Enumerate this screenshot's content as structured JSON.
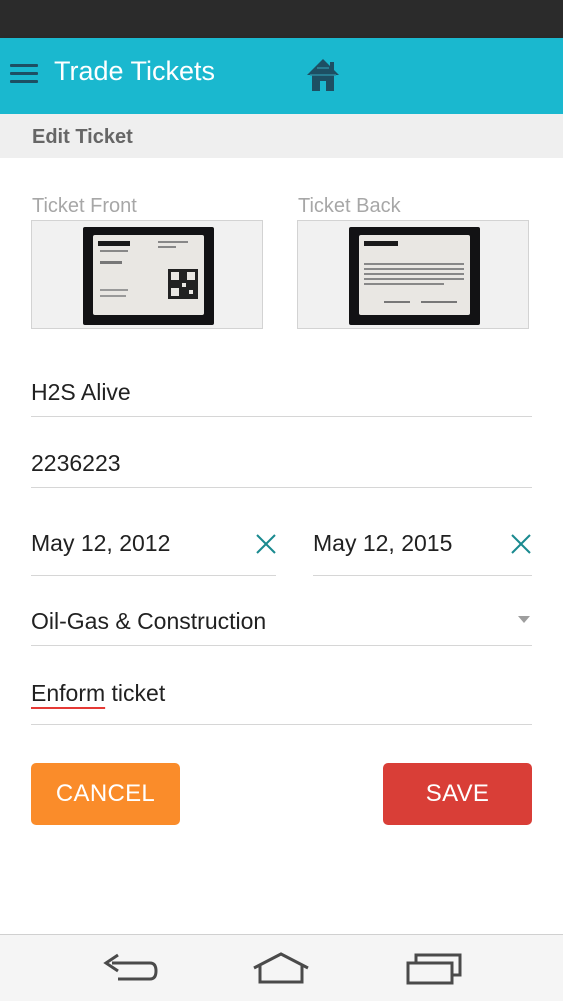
{
  "app_bar": {
    "title": "Trade Tickets",
    "color": "#1ab8cf"
  },
  "subheader": {
    "title": "Edit Ticket"
  },
  "images": {
    "front_label": "Ticket Front",
    "back_label": "Ticket Back"
  },
  "form": {
    "ticket_name": "H2S Alive",
    "ticket_number": "2236223",
    "issue_date": "May 12, 2012",
    "expiry_date": "May 12, 2015",
    "category": "Oil-Gas & Construction",
    "notes_word1": "Enform",
    "notes_word2": " ticket"
  },
  "buttons": {
    "cancel_label": "CANCEL",
    "cancel_color": "#fa8c2a",
    "save_label": "SAVE",
    "save_color": "#d93e37"
  },
  "icons": {
    "menu": "menu-icon",
    "home": "home-icon",
    "clear": "close-icon",
    "back": "back-icon",
    "nav_home": "home-icon",
    "recents": "recents-icon"
  }
}
